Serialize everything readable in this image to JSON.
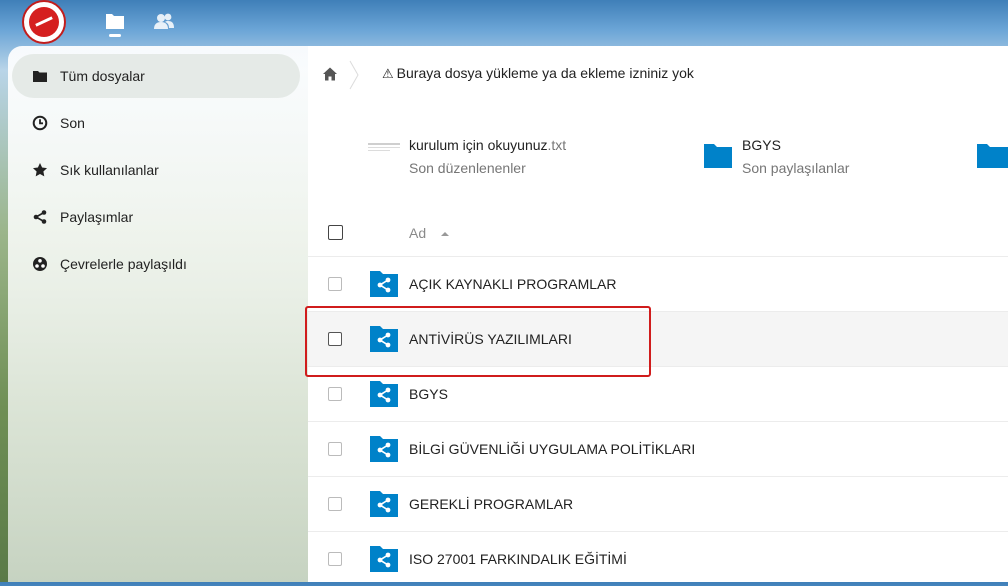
{
  "header": {
    "logo": "university-logo",
    "apps": [
      {
        "name": "files",
        "icon": "folder-icon"
      },
      {
        "name": "contacts",
        "icon": "contacts-icon"
      }
    ]
  },
  "sidebar": {
    "items": [
      {
        "label": "Tüm dosyalar",
        "icon": "folder-icon",
        "active": true
      },
      {
        "label": "Son",
        "icon": "clock-icon"
      },
      {
        "label": "Sık kullanılanlar",
        "icon": "star-icon"
      },
      {
        "label": "Paylaşımlar",
        "icon": "share-icon"
      },
      {
        "label": "Çevrelerle paylaşıldı",
        "icon": "circles-icon"
      }
    ]
  },
  "breadcrumb": {
    "home_icon": "home-icon",
    "warning": "Buraya dosya yükleme ya da ekleme izniniz yok",
    "warning_icon": "⚠"
  },
  "recent": [
    {
      "name": "kurulum için okuyunuz",
      "ext": ".txt",
      "sub": "Son düzenlenenler",
      "icon": "text-file-icon"
    },
    {
      "name": "BGYS",
      "ext": "",
      "sub": "Son paylaşılanlar",
      "icon": "folder-icon"
    }
  ],
  "list": {
    "column_name": "Ad",
    "rows": [
      {
        "name": "AÇIK KAYNAKLI PROGRAMLAR"
      },
      {
        "name": "ANTİVİRÜS YAZILIMLARI",
        "highlighted": true
      },
      {
        "name": "BGYS"
      },
      {
        "name": "BİLGİ GÜVENLİĞİ UYGULAMA POLİTİKLARI"
      },
      {
        "name": "GEREKLİ PROGRAMLAR"
      },
      {
        "name": "ISO 27001 FARKINDALIK EĞİTİMİ"
      }
    ]
  },
  "colors": {
    "accent": "#0082c9",
    "highlight_border": "#d01c1c"
  }
}
